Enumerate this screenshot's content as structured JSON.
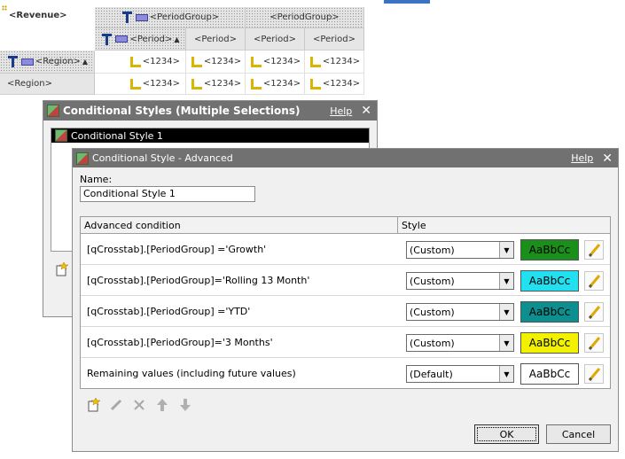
{
  "crosstab": {
    "corner": "<Revenue>",
    "period_group_1": "<PeriodGroup>",
    "period_group_2": "<PeriodGroup>",
    "period_headers": [
      "<Period>",
      "<Period>",
      "<Period>",
      "<Period>"
    ],
    "rows": [
      {
        "label": "<Region>",
        "values": [
          "<1234>",
          "<1234>",
          "<1234>",
          "<1234>"
        ]
      },
      {
        "label": "<Region>",
        "values": [
          "<1234>",
          "<1234>",
          "<1234>",
          "<1234>"
        ]
      }
    ]
  },
  "dialog_multi": {
    "title": "Conditional Styles (Multiple Selections)",
    "help": "Help",
    "close": "✕",
    "list_items": [
      "Conditional Style 1"
    ]
  },
  "dialog_advanced": {
    "title": "Conditional Style - Advanced",
    "help": "Help",
    "close": "✕",
    "name_label": "Name:",
    "name_value": "Conditional Style 1",
    "col_condition": "Advanced condition",
    "col_style": "Style",
    "rows": [
      {
        "condition": "[qCrosstab].[PeriodGroup] ='Growth'",
        "style": "(Custom)",
        "sample": "AaBbCc",
        "bg": "#1a8f1a",
        "fg": "#000000"
      },
      {
        "condition": "[qCrosstab].[PeriodGroup]='Rolling 13 Month'",
        "style": "(Custom)",
        "sample": "AaBbCc",
        "bg": "#22e0ef",
        "fg": "#000000"
      },
      {
        "condition": "[qCrosstab].[PeriodGroup] ='YTD'",
        "style": "(Custom)",
        "sample": "AaBbCc",
        "bg": "#0d8f8f",
        "fg": "#000000"
      },
      {
        "condition": "[qCrosstab].[PeriodGroup]='3 Months'",
        "style": "(Custom)",
        "sample": "AaBbCc",
        "bg": "#f2f200",
        "fg": "#000000"
      },
      {
        "condition": "Remaining values (including future values)",
        "style": "(Default)",
        "sample": "AaBbCc",
        "bg": "#ffffff",
        "fg": "#000000"
      }
    ],
    "ok": "OK",
    "cancel": "Cancel"
  }
}
